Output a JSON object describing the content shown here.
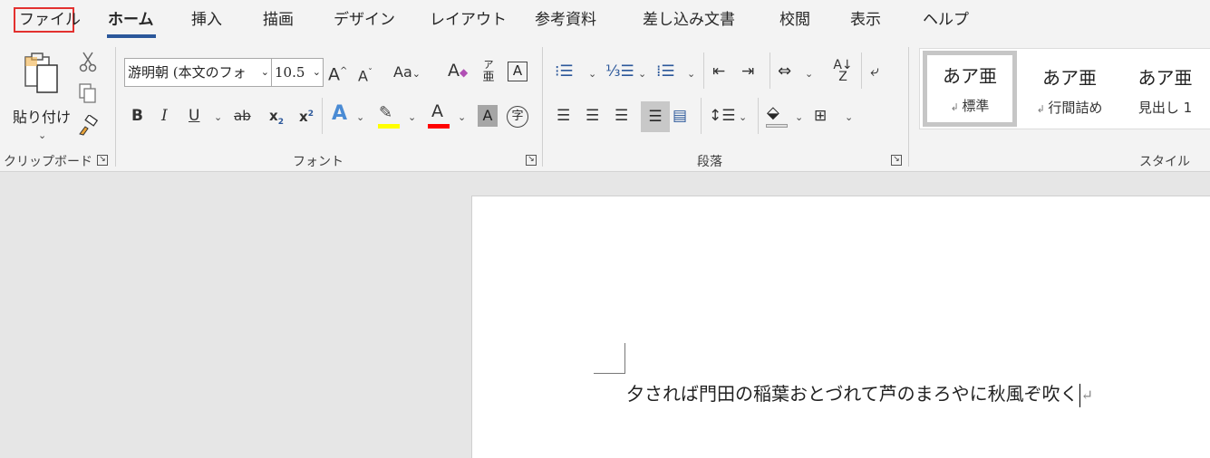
{
  "tabs": {
    "file": "ファイル",
    "home": "ホーム",
    "insert": "挿入",
    "draw": "描画",
    "design": "デザイン",
    "layout": "レイアウト",
    "references": "参考資料",
    "mailings": "差し込み文書",
    "review": "校閲",
    "view": "表示",
    "help": "ヘルプ"
  },
  "clipboard": {
    "paste_label": "貼り付け",
    "group_label": "クリップボード"
  },
  "font": {
    "font_name": "游明朝 (本文のフォ",
    "font_size": "10.5",
    "group_label": "フォント",
    "ruby_top": "ア",
    "ruby_bottom": "亜",
    "aa_label": "Aa"
  },
  "paragraph": {
    "group_label": "段落"
  },
  "styles": {
    "group_label": "スタイル",
    "items": [
      {
        "sample": "あア亜",
        "name": "標準"
      },
      {
        "sample": "あア亜",
        "name": "行間詰め"
      },
      {
        "sample": "あア亜",
        "name": "見出し 1"
      }
    ]
  },
  "colors": {
    "accent": "#2b579a",
    "highlight": "#ffff00",
    "font_color": "#ff0000",
    "file_box": "#e3312f"
  },
  "document": {
    "text": "夕されば門田の稲葉おとづれて芦のまろやに秋風ぞ吹く"
  }
}
